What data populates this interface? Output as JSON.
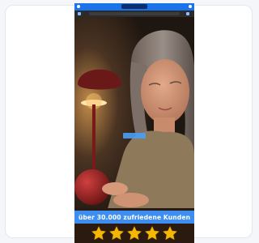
{
  "ad": {
    "banner_text": "über 30.000 zufriedene Kunden",
    "rating": {
      "stars": 5,
      "max": 5
    },
    "colors": {
      "banner": "#3d8ef0",
      "star": "#f5b800",
      "status_bar": "#1a73e8"
    }
  },
  "icons": {
    "star": "star-icon",
    "play": "play-button"
  }
}
